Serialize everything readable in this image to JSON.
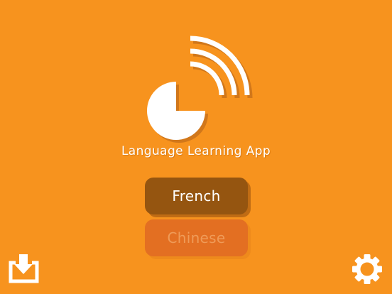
{
  "app": {
    "title": "Language Learning App"
  },
  "languages": [
    {
      "label": "French",
      "selected": true
    },
    {
      "label": "Chinese",
      "selected": false
    }
  ],
  "icons": {
    "logo": "pie-broadcast-logo-icon",
    "download": "download-icon",
    "settings": "gear-icon"
  },
  "colors": {
    "background": "#f7931e",
    "selected_button": "#955510",
    "unselected_button": "#e36f22",
    "unselected_text": "#ef9b58",
    "foreground": "#ffffff"
  }
}
